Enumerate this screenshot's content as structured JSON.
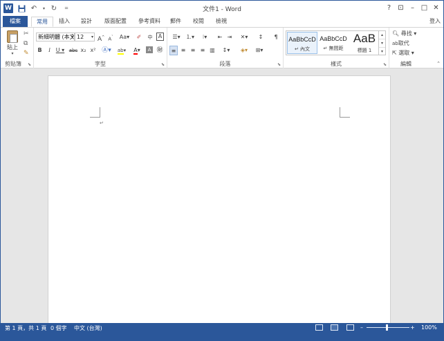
{
  "title_bar": {
    "title": "文件1 - Word",
    "qat": {
      "save_icon": "save-icon",
      "undo_icon": "undo-icon",
      "redo_icon": "redo-icon",
      "customize_icon": "customize-icon"
    },
    "help": "?",
    "ribbon_display": "⊡",
    "minimize": "–",
    "maximize": "□",
    "close": "✕"
  },
  "tabs": {
    "file": "檔案",
    "home": "常用",
    "insert": "插入",
    "design": "設計",
    "layout": "版面配置",
    "references": "參考資料",
    "mailings": "郵件",
    "review": "校閱",
    "view": "檢視",
    "sign_in": "登入"
  },
  "clipboard": {
    "paste": "貼上",
    "label": "剪貼簿"
  },
  "font": {
    "font_name": "新細明體 (本文",
    "font_size": "12",
    "grow": "A",
    "shrink": "A",
    "change_case": "Aa",
    "bold": "B",
    "italic": "I",
    "underline": "U",
    "strikethrough": "abc",
    "subscript": "x₂",
    "superscript": "x²",
    "label": "字型"
  },
  "paragraph": {
    "label": "段落"
  },
  "styles": {
    "items": [
      {
        "sample": "AaBbCcD",
        "name": "↵ 內文"
      },
      {
        "sample": "AaBbCcD",
        "name": "↵ 無間距"
      },
      {
        "sample": "AaB",
        "name": "標題 1"
      }
    ],
    "label": "樣式"
  },
  "editing": {
    "find": "尋找",
    "replace": "取代",
    "select": "選取",
    "label": "編輯"
  },
  "document": {
    "paragraph_mark": "↵"
  },
  "status_bar": {
    "page": "第 1 頁，共 1 頁",
    "words": "0 個字",
    "language": "中文 (台灣)",
    "zoom_minus": "–",
    "zoom_plus": "+",
    "zoom": "100%",
    "zoom_level": 1.0
  },
  "colors": {
    "accent": "#2b579a",
    "background": "#e6e6e6"
  }
}
